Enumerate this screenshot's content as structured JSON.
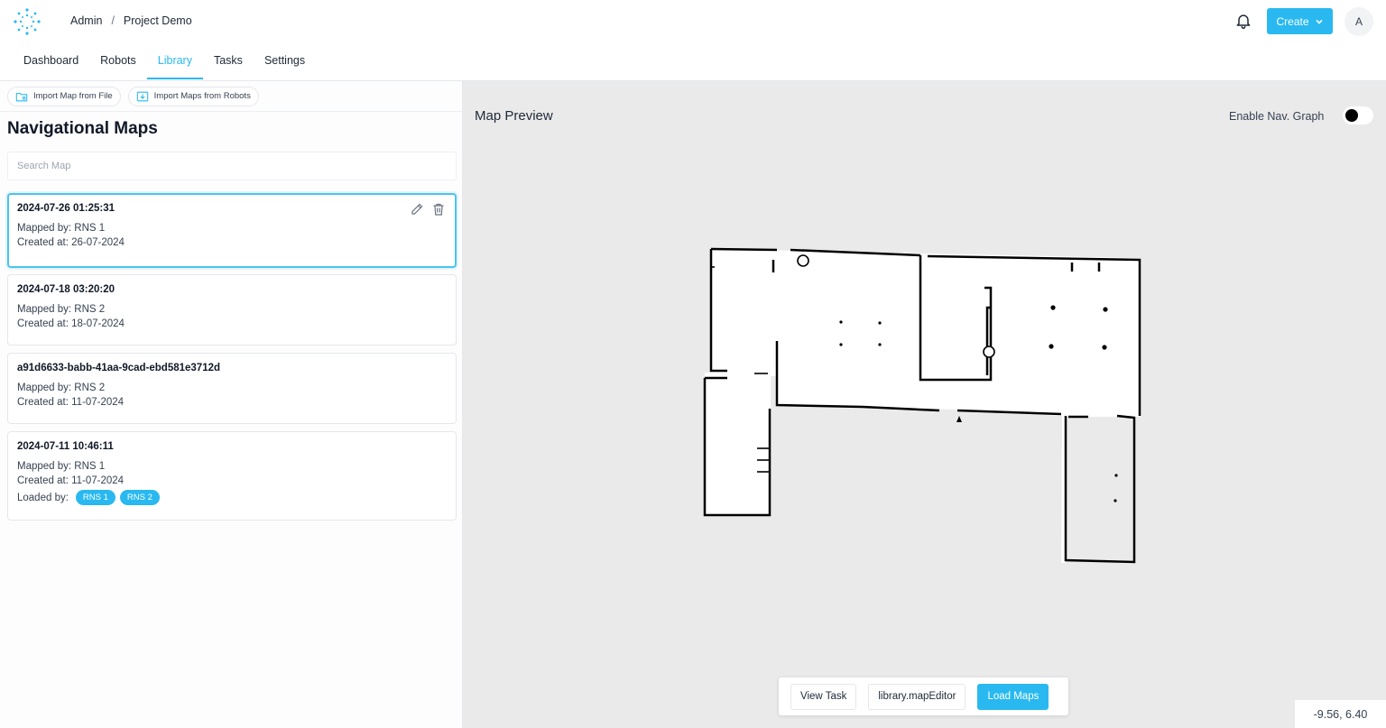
{
  "breadcrumb": {
    "root": "Admin",
    "separator": "/",
    "current": "Project Demo"
  },
  "header": {
    "create_label": "Create",
    "avatar_initial": "A",
    "icons": [
      "logo-icon",
      "bell-icon",
      "chevron-down-icon"
    ]
  },
  "nav": {
    "tabs": [
      {
        "label": "Dashboard"
      },
      {
        "label": "Robots"
      },
      {
        "label": "Library"
      },
      {
        "label": "Tasks"
      },
      {
        "label": "Settings"
      }
    ],
    "active": "Library"
  },
  "library": {
    "import_file_label": "Import Map from File",
    "import_robots_label": "Import Maps from Robots",
    "title": "Navigational Maps",
    "search_placeholder": "Search Map",
    "maps": [
      {
        "name": "2024-07-26 01:25:31",
        "mapped_by": "Mapped by: RNS 1",
        "created_at": "Created at: 26-07-2024"
      },
      {
        "name": "2024-07-18 03:20:20",
        "mapped_by": "Mapped by: RNS 2",
        "created_at": "Created at: 18-07-2024"
      },
      {
        "name": "a91d6633-babb-41aa-9cad-ebd581e3712d",
        "mapped_by": "Mapped by: RNS 2",
        "created_at": "Created at: 11-07-2024"
      },
      {
        "name": "2024-07-11 10:46:11",
        "mapped_by": "Mapped by: RNS 1",
        "created_at": "Created at: 11-07-2024",
        "loaded_by_label": "Loaded by:",
        "loaded_by": [
          "RNS 1",
          "RNS 2"
        ]
      }
    ]
  },
  "preview": {
    "title": "Map Preview",
    "nav_graph_label": "Enable Nav. Graph",
    "nav_graph_enabled": false,
    "view_task_label": "View Task",
    "map_editor_label": "library.mapEditor",
    "load_maps_label": "Load Maps",
    "coordinates": "-9.56, 6.40"
  },
  "colors": {
    "accent": "#29b9f0",
    "map_background": "#eaeaea"
  }
}
